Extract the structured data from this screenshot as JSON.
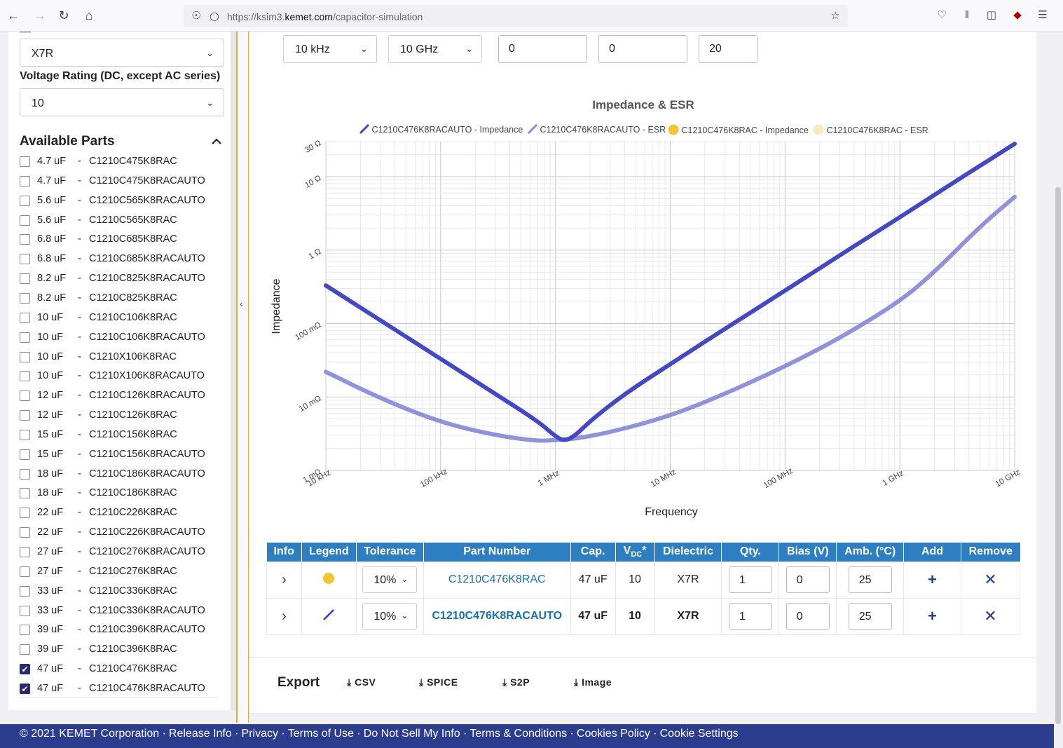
{
  "browser": {
    "url_prefix": "https://ksim3.",
    "url_domain": "kemet.com",
    "url_path": "/capacitor-simulation"
  },
  "sidebar": {
    "dielectric_value": "X7R",
    "voltage_label": "Voltage Rating (DC, except AC series)",
    "voltage_value": "10",
    "available_title": "Available Parts",
    "parts": [
      {
        "cap": "4.7 uF",
        "part": "C1210C475K8RAC",
        "checked": false
      },
      {
        "cap": "4.7 uF",
        "part": "C1210C475K8RACAUTO",
        "checked": false
      },
      {
        "cap": "5.6 uF",
        "part": "C1210C565K8RACAUTO",
        "checked": false
      },
      {
        "cap": "5.6 uF",
        "part": "C1210C565K8RAC",
        "checked": false
      },
      {
        "cap": "6.8 uF",
        "part": "C1210C685K8RAC",
        "checked": false
      },
      {
        "cap": "6.8 uF",
        "part": "C1210C685K8RACAUTO",
        "checked": false
      },
      {
        "cap": "8.2 uF",
        "part": "C1210C825K8RACAUTO",
        "checked": false
      },
      {
        "cap": "8.2 uF",
        "part": "C1210C825K8RAC",
        "checked": false
      },
      {
        "cap": "10 uF",
        "part": "C1210C106K8RAC",
        "checked": false
      },
      {
        "cap": "10 uF",
        "part": "C1210C106K8RACAUTO",
        "checked": false
      },
      {
        "cap": "10 uF",
        "part": "C1210X106K8RAC",
        "checked": false
      },
      {
        "cap": "10 uF",
        "part": "C1210X106K8RACAUTO",
        "checked": false
      },
      {
        "cap": "12 uF",
        "part": "C1210C126K8RACAUTO",
        "checked": false
      },
      {
        "cap": "12 uF",
        "part": "C1210C126K8RAC",
        "checked": false
      },
      {
        "cap": "15 uF",
        "part": "C1210C156K8RAC",
        "checked": false
      },
      {
        "cap": "15 uF",
        "part": "C1210C156K8RACAUTO",
        "checked": false
      },
      {
        "cap": "18 uF",
        "part": "C1210C186K8RACAUTO",
        "checked": false
      },
      {
        "cap": "18 uF",
        "part": "C1210C186K8RAC",
        "checked": false
      },
      {
        "cap": "22 uF",
        "part": "C1210C226K8RAC",
        "checked": false
      },
      {
        "cap": "22 uF",
        "part": "C1210C226K8RACAUTO",
        "checked": false
      },
      {
        "cap": "27 uF",
        "part": "C1210C276K8RACAUTO",
        "checked": false
      },
      {
        "cap": "27 uF",
        "part": "C1210C276K8RAC",
        "checked": false
      },
      {
        "cap": "33 uF",
        "part": "C1210C336K8RAC",
        "checked": false
      },
      {
        "cap": "33 uF",
        "part": "C1210C336K8RACAUTO",
        "checked": false
      },
      {
        "cap": "39 uF",
        "part": "C1210C396K8RACAUTO",
        "checked": false
      },
      {
        "cap": "39 uF",
        "part": "C1210C396K8RAC",
        "checked": false
      },
      {
        "cap": "47 uF",
        "part": "C1210C476K8RAC",
        "checked": true
      },
      {
        "cap": "47 uF",
        "part": "C1210C476K8RACAUTO",
        "checked": true
      }
    ]
  },
  "controls": {
    "freq_start": "10 kHz",
    "freq_stop": "10 GHz",
    "field_a": "0",
    "field_b": "0",
    "field_c": "20"
  },
  "chart_data": {
    "type": "line",
    "title": "Impedance & ESR",
    "xlabel": "Frequency",
    "ylabel": "Impedance",
    "x_scale": "log",
    "y_scale": "log",
    "x_ticks": [
      "10 kHz",
      "100 kHz",
      "1 MHz",
      "10 MHz",
      "100 MHz",
      "1 GHz",
      "10 GHz"
    ],
    "y_ticks": [
      "1 mΩ",
      "10 mΩ",
      "100 mΩ",
      "1 Ω",
      "10 Ω",
      "30 Ω"
    ],
    "xlim_hz": [
      10000,
      10000000000
    ],
    "ylim_ohm": [
      0.001,
      30
    ],
    "legend": [
      {
        "name": "C1210C476K8RACAUTO - Impedance",
        "color": "#4548c4",
        "marker": "line"
      },
      {
        "name": "C1210C476K8RACAUTO - ESR",
        "color": "#8a8ce0",
        "marker": "line"
      },
      {
        "name": "C1210C476K8RAC - Impedance",
        "color": "#f3c535",
        "marker": "dot"
      },
      {
        "name": "C1210C476K8RAC - ESR",
        "color": "#f7ecc0",
        "marker": "dot"
      }
    ],
    "series": [
      {
        "name": "C1210C476K8RACAUTO - Impedance",
        "x": [
          10000,
          30000,
          100000,
          300000,
          700000,
          1000000,
          1200000,
          1500000,
          2000000,
          4000000,
          10000000,
          30000000,
          100000000,
          300000000,
          1000000000,
          3000000000,
          10000000000
        ],
        "y": [
          0.33,
          0.11,
          0.033,
          0.011,
          0.0047,
          0.0029,
          0.0025,
          0.003,
          0.0047,
          0.011,
          0.028,
          0.085,
          0.28,
          0.85,
          2.8,
          8.5,
          28
        ]
      },
      {
        "name": "C1210C476K8RACAUTO - ESR",
        "x": [
          10000,
          30000,
          100000,
          300000,
          700000,
          1000000,
          1500000,
          3000000,
          10000000,
          30000000,
          100000000,
          300000000,
          1000000000,
          2000000000,
          5000000000,
          10000000000
        ],
        "y": [
          0.022,
          0.0095,
          0.0045,
          0.003,
          0.0025,
          0.0026,
          0.0027,
          0.0033,
          0.0055,
          0.011,
          0.026,
          0.063,
          0.2,
          0.5,
          2.1,
          5.3
        ]
      }
    ]
  },
  "table": {
    "headers": [
      "Info",
      "Legend",
      "Tolerance",
      "Part Number",
      "Cap.",
      "VDC*",
      "Dielectric",
      "Qty.",
      "Bias (V)",
      "Amb. (°C)",
      "Add",
      "Remove"
    ],
    "vdc_main": "V",
    "vdc_sub": "DC",
    "vdc_sup": "*",
    "rows": [
      {
        "tolerance": "10%",
        "part": "C1210C476K8RAC",
        "cap": "47 uF",
        "vdc": "10",
        "dielectric": "X7R",
        "qty": "1",
        "bias": "0",
        "amb": "25",
        "legend": "dot",
        "legend_color": "#f3c535"
      },
      {
        "tolerance": "10%",
        "part": "C1210C476K8RACAUTO",
        "cap": "47 uF",
        "vdc": "10",
        "dielectric": "X7R",
        "qty": "1",
        "bias": "0",
        "amb": "25",
        "legend": "line",
        "legend_color": "#3a3fb8"
      }
    ]
  },
  "export": {
    "title": "Export",
    "buttons": [
      "CSV",
      "SPICE",
      "S2P",
      "Image"
    ]
  },
  "footer": {
    "links": [
      "© 2021 KEMET Corporation",
      "Release Info",
      "Privacy",
      "Terms of Use",
      "Do Not Sell My Info",
      "Terms & Conditions",
      "Cookies Policy",
      "Cookie Settings"
    ]
  }
}
